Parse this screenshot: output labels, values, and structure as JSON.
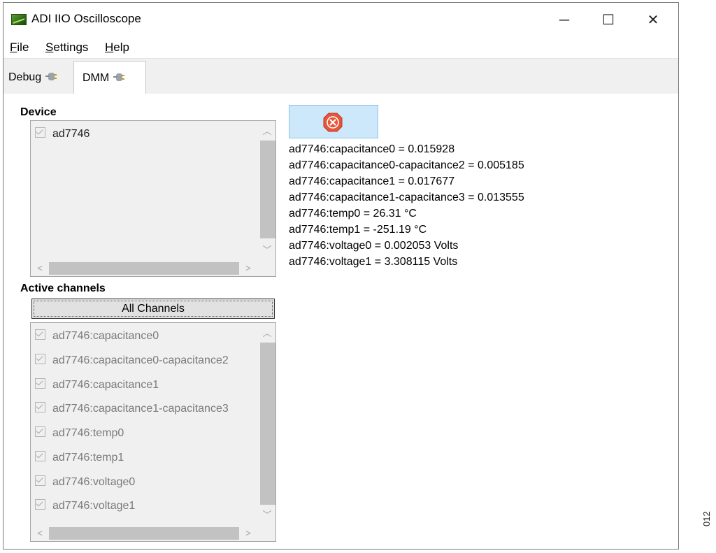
{
  "window": {
    "title": "ADI IIO Oscilloscope",
    "controls": {
      "minimize": "─",
      "maximize": "☐",
      "close": "✕"
    }
  },
  "menu": [
    {
      "mnemonic": "F",
      "rest": "ile"
    },
    {
      "mnemonic": "S",
      "rest": "ettings"
    },
    {
      "mnemonic": "H",
      "rest": "elp"
    }
  ],
  "tabs": [
    {
      "label": "Debug",
      "icon": "plug-icon",
      "active": false
    },
    {
      "label": "DMM",
      "icon": "plug-icon",
      "active": true
    }
  ],
  "device": {
    "label": "Device",
    "items": [
      {
        "label": "ad7746",
        "checked": true
      }
    ]
  },
  "active_channels": {
    "label": "Active channels",
    "all_button": "All Channels",
    "items": [
      {
        "label": "ad7746:capacitance0",
        "checked": true
      },
      {
        "label": "ad7746:capacitance0-capacitance2",
        "checked": true
      },
      {
        "label": "ad7746:capacitance1",
        "checked": true
      },
      {
        "label": "ad7746:capacitance1-capacitance3",
        "checked": true
      },
      {
        "label": "ad7746:temp0",
        "checked": true
      },
      {
        "label": "ad7746:temp1",
        "checked": true
      },
      {
        "label": "ad7746:voltage0",
        "checked": true
      },
      {
        "label": "ad7746:voltage1",
        "checked": true
      }
    ]
  },
  "stop_button": {
    "icon": "stop-icon",
    "color": "#e8553a"
  },
  "readings": [
    "ad7746:capacitance0 = 0.015928",
    "ad7746:capacitance0-capacitance2 = 0.005185",
    "ad7746:capacitance1 = 0.017677",
    "ad7746:capacitance1-capacitance3 = 0.013555",
    "ad7746:temp0 = 26.31 °C",
    "ad7746:temp1 = -251.19 °C",
    "ad7746:voltage0 = 0.002053 Volts",
    "ad7746:voltage1 = 3.308115 Volts"
  ],
  "figure_code": "012"
}
